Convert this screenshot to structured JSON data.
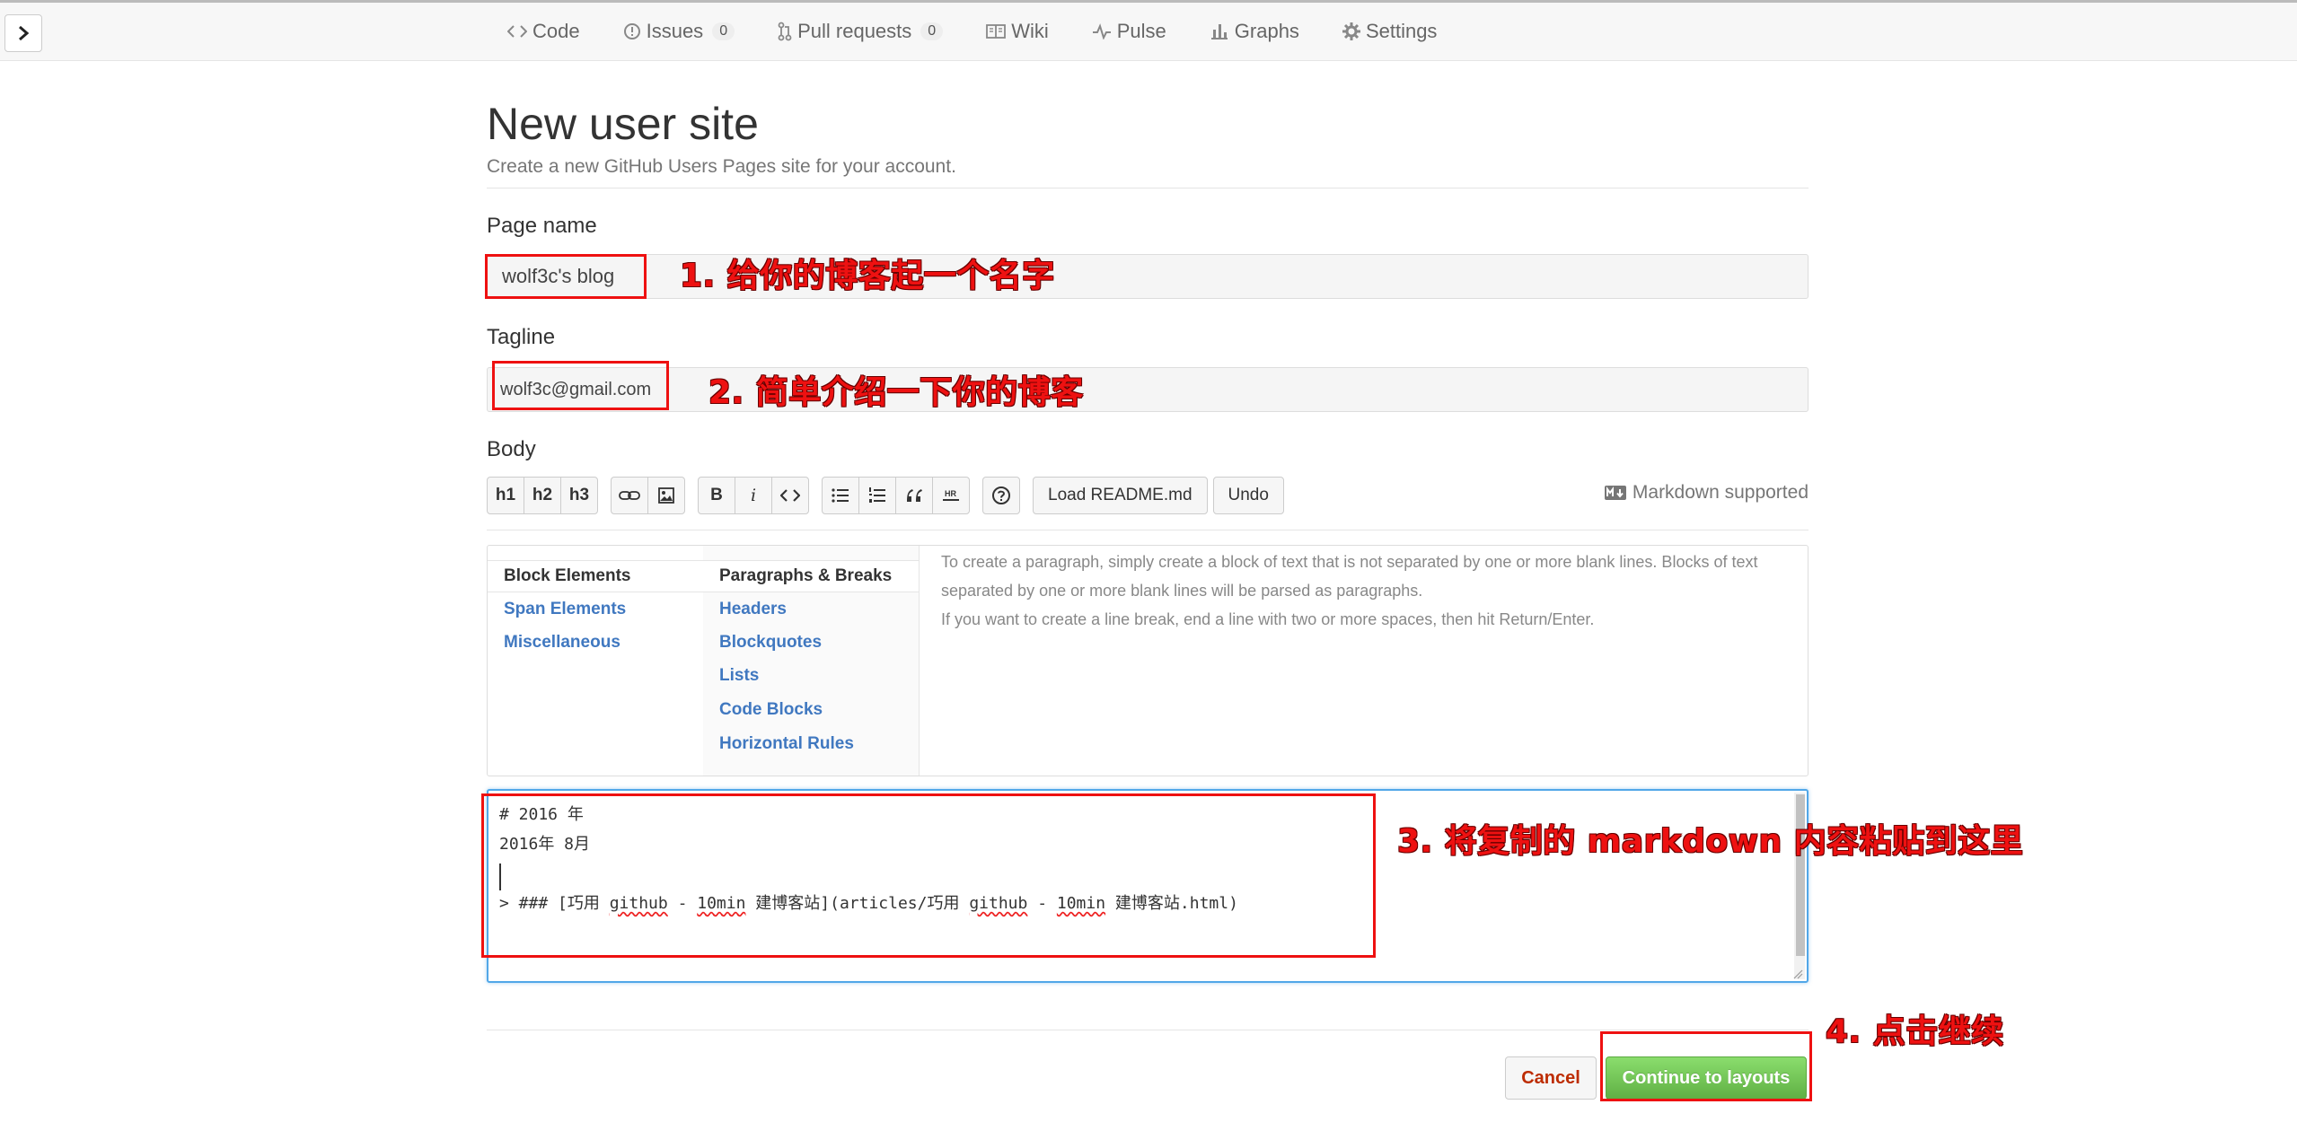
{
  "nav": {
    "tabs": [
      {
        "label": "Code",
        "icon": "code-icon"
      },
      {
        "label": "Issues",
        "icon": "issue-icon",
        "count": "0"
      },
      {
        "label": "Pull requests",
        "icon": "pull-request-icon",
        "count": "0"
      },
      {
        "label": "Wiki",
        "icon": "book-icon"
      },
      {
        "label": "Pulse",
        "icon": "pulse-icon"
      },
      {
        "label": "Graphs",
        "icon": "graph-icon"
      },
      {
        "label": "Settings",
        "icon": "gear-icon"
      }
    ]
  },
  "page": {
    "title": "New user site",
    "subtitle": "Create a new GitHub Users Pages site for your account."
  },
  "form": {
    "page_name_label": "Page name",
    "page_name_value": "wolf3c's blog",
    "tagline_label": "Tagline",
    "tagline_value": "wolf3c@gmail.com",
    "body_label": "Body"
  },
  "toolbar": {
    "h1": "h1",
    "h2": "h2",
    "h3": "h3",
    "bold": "B",
    "italic": "i",
    "load_readme": "Load README.md",
    "undo": "Undo",
    "markdown_supported": "Markdown supported"
  },
  "help": {
    "col1": [
      "Block Elements",
      "Span Elements",
      "Miscellaneous"
    ],
    "col2": [
      "Paragraphs & Breaks",
      "Headers",
      "Blockquotes",
      "Lists",
      "Code Blocks",
      "Horizontal Rules"
    ],
    "text_1": "To create a paragraph, simply create a block of text that is not separated by one or more blank lines. Blocks of text separated by one or more blank lines will be parsed as paragraphs.",
    "text_2": "If you want to create a line break, end a line with two or more spaces, then hit Return/Enter."
  },
  "editor": {
    "line1": "# 2016 年",
    "line2": "2016年 8月",
    "line4_a": "> ### [巧用 ",
    "line4_b": "github",
    "line4_c": " - ",
    "line4_d": "10min",
    "line4_e": " 建博客站](articles/巧用 ",
    "line4_f": "github",
    "line4_g": " - ",
    "line4_h": "10min",
    "line4_i": " 建博客站.html)"
  },
  "actions": {
    "cancel": "Cancel",
    "continue": "Continue to layouts"
  },
  "annotations": {
    "a1": "1. 给你的博客起一个名字",
    "a2": "2. 简单介绍一下你的博客",
    "a3": "3. 将复制的 markdown 内容粘贴到这里",
    "a4": "4. 点击继续"
  },
  "colors": {
    "annotation_red": "#ee1111",
    "link_blue": "#4078c0",
    "continue_green": "#60b044",
    "cancel_red": "#bd2c00"
  }
}
